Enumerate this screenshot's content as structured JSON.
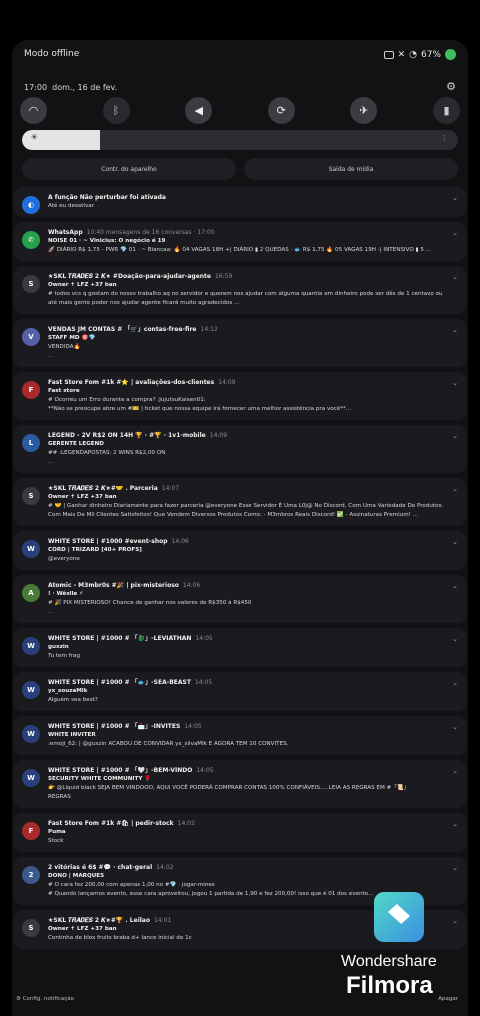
{
  "status": {
    "left_text": "Modo offline",
    "battery": "67%"
  },
  "datebar": {
    "time": "17:00",
    "date": "dom., 16 de fev."
  },
  "quick_settings": {
    "icons": [
      "wifi-icon",
      "bluetooth-icon",
      "sound-icon",
      "rotate-icon",
      "airplane-icon",
      "flashlight-icon"
    ]
  },
  "brightness": {
    "level": 0.18
  },
  "pills": {
    "device_control": "Contr. do aparelho",
    "media_output": "Saída de mídia"
  },
  "notifications": [
    {
      "avatar": "◐",
      "color": "#1e6fd9",
      "title": "A função Não perturbar foi ativada",
      "time": "",
      "lines": [
        "Até eu desativar"
      ]
    },
    {
      "avatar": "✆",
      "color": "#25a04b",
      "title": "WhatsApp",
      "time": "10:40 mensagens de 16 conversas · 17:00",
      "lines": [
        "NOISE 01 · ~ Vinicius: O negócio é 19",
        "🚀 DIÁRIO R$ 1,75 - PWR 💎 01 · ~ Biancaa: 🔥 04 VAGAS 18H +| DIÁRIO ▮ 2 QUEDAS · 🐟 R$ 1,75 🔥 05 VAGAS 19H -| INTENSIVO ▮ 5 ..."
      ]
    },
    {
      "avatar": "S",
      "color": "#3a3a44",
      "title": "★SKL 𝑻𝑹𝑨𝑫𝑬𝑺 2 𝑲★ #Doação-para-ajudar-agente",
      "time": "16:59",
      "lines": [
        "Owner ✝ LFZ +37 ban",
        "# todos vcs q gostam do nosso trabalho aq no servidor e querem nos ajudar com alguma quantia em dinheiro pode ser dês de 1 centavo ou até mais gente poder nos ajudar agente ficará muito agradecidos ..."
      ]
    },
    {
      "avatar": "V",
      "color": "#5560a8",
      "title": "VENDAS JM CONTAS # 「🛒」contas-free-fire",
      "time": "14:12",
      "lines": [
        "STAFF MD 🎯💎",
        "VENDIDA🔥",
        "..."
      ]
    },
    {
      "avatar": "F",
      "color": "#a82a2a",
      "title": "Fast Store Fom #1k #⭐ | avaliações-dos-clientes",
      "time": "14:09",
      "lines": [
        "Fast store",
        "# Ocorreu um Erro durante a compra? :JujutsuKaisen01:",
        "**Não se preocupe abre um #🎫 | ticket  que nossa equipe irá fornecer uma melhor assistência pra você**..."
      ]
    },
    {
      "avatar": "L",
      "color": "#2c5aa0",
      "title": "LEGEND - 2V R$2 ON 14H 🏆 · #🏆 · 1v1-mobile",
      "time": "14:09",
      "lines": [
        "GERENTE LEGEND",
        "## :LEGENDAPOSTAS:  2 WINS R$2,00 ON",
        "..."
      ]
    },
    {
      "avatar": "S",
      "color": "#3a3a44",
      "title": "★SKL 𝑻𝑹𝑨𝑫𝑬𝑺 2 𝑲★#🤝 . Parceria",
      "time": "14:07",
      "lines": [
        "Owner ✝ LFZ +37 ban",
        "# 🤝 | Ganhar dinheiro Diariamente para fazer parceria  @everyone  Esse Servidor É Uma L0j@ No Discord, Com Uma Variedade De Produtos. Com Mais De Mil Clientes Satisfeitos! Que Vendem Diversos Produtos Como:  - M3mbros Reais Discord! ✅ - Assinaturas Premium! ..."
      ]
    },
    {
      "avatar": "W",
      "color": "#2b3f7a",
      "title": "WHITE STORE | #1000 #event-shop",
      "time": "14:06",
      "lines": [
        "CORD | TRIZARD [40+ PROFS]",
        "@everyone"
      ]
    },
    {
      "avatar": "A",
      "color": "#4a7a3a",
      "title": "Atomic - M3mbr0s #🎉 | pix-misterioso",
      "time": "14:06",
      "lines": [
        "! · Wêslle ⚡",
        "# 🎉 PIX MISTERIOSO! Chance de ganhar nos valores de R$350 à R$450",
        "..."
      ]
    },
    {
      "avatar": "W",
      "color": "#2b3f7a",
      "title": "WHITE STORE | #1000 # 「🐉」-LEVIATHAN",
      "time": "14:05",
      "lines": [
        "guxzin",
        "Tu tem frag"
      ]
    },
    {
      "avatar": "W",
      "color": "#2b3f7a",
      "title": "WHITE STORE | #1000 # 「🐟」-SEA-BEAST",
      "time": "14:05",
      "lines": [
        "yx_souzaMlk",
        "Alguém sea best?"
      ]
    },
    {
      "avatar": "W",
      "color": "#2b3f7a",
      "title": "WHITE STORE | #1000 # 「📩」-INVITES",
      "time": "14:05",
      "lines": [
        "WHITE INVITER",
        ":emoji_62: | @guxzin ACABOU DE CONVIDAR yx_silvaMlk E AGORA TEM  10 CONVITES."
      ]
    },
    {
      "avatar": "W",
      "color": "#2b3f7a",
      "title": "WHITE STORE | #1000 # 「🤍」-BEM-VINDO",
      "time": "14:05",
      "lines": [
        "SECURITY WHITE COMMUNITY 🌹",
        "👉 @Liquid black SEJA BEM VINDOOO, AQUI VOCÊ PODERÁ COMPRAR CONTAS 100% CONFIÁVEIS.....LEIA AS REGRAS EM #「📜」",
        "REGRAS"
      ]
    },
    {
      "avatar": "F",
      "color": "#a82a2a",
      "title": "Fast Store Fom #1k #🛍 | pedir-stock",
      "time": "14:02",
      "lines": [
        "Puma",
        "Stock"
      ]
    },
    {
      "avatar": "2",
      "color": "#3a5a8a",
      "title": "2 vitórias é 6$ #💬 · chat-geral",
      "time": "14:02",
      "lines": [
        "DONO | MARQUES",
        "# O cara fez 200,00 com apenas 1,00 no #💎 · jogar-mines",
        "# Quando lançamos evento, esse cara aproveitou, jogou 1 partida de 1,90 e fez 200,00! isso que é 01 dos evento..."
      ]
    },
    {
      "avatar": "S",
      "color": "#3a3a44",
      "title": "★SKL 𝑻𝑹𝑨𝑫𝑬𝑺 2 𝑲★#🏆 . Leilao",
      "time": "14:01",
      "lines": [
        "Owner ✝ LFZ +37 ban",
        "Continha de blox fruits braba d+ lance inicial de 1c"
      ]
    }
  ],
  "footer": {
    "settings": "Config. notificação",
    "clear": "Apagar"
  },
  "watermark": {
    "line1": "Wondershare",
    "line2": "Filmora"
  }
}
